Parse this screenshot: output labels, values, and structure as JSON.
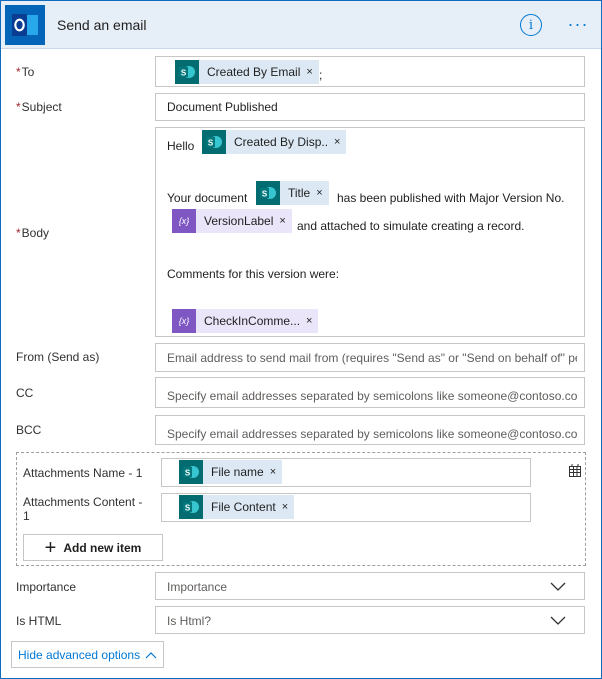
{
  "header": {
    "title": "Send an email",
    "app_icon": "outlook-icon",
    "info_icon": "info-icon",
    "more_icon": "more-ellipsis-icon"
  },
  "to": {
    "label": "To",
    "required_mark": "*",
    "token": {
      "label": "Created By Email",
      "remove": "×",
      "icon": "sharepoint-icon"
    },
    "separator": ";"
  },
  "subject": {
    "label": "Subject",
    "required_mark": "*",
    "value": "Document Published"
  },
  "body": {
    "label": "Body",
    "required_mark": "*",
    "hello": "Hello",
    "token_created_by": {
      "label": "Created By Disp..",
      "remove": "×",
      "icon": "sharepoint-icon"
    },
    "your_document": "Your document",
    "token_title": {
      "label": "Title",
      "remove": "×",
      "icon": "sharepoint-icon"
    },
    "published_text": "has been published with Major Version No.",
    "token_version": {
      "label": "VersionLabel",
      "remove": "×",
      "icon": "variable-icon",
      "icon_glyph": "{x}"
    },
    "attached_text": "and attached to simulate creating a record.",
    "comments_text": "Comments for this version were:",
    "token_checkin": {
      "label": "CheckInComme...",
      "remove": "×",
      "icon": "variable-icon",
      "icon_glyph": "{x}"
    }
  },
  "from": {
    "label": "From (Send as)",
    "placeholder": "Email address to send mail from (requires \"Send as\" or \"Send on behalf of\" pe"
  },
  "cc": {
    "label": "CC",
    "placeholder": "Specify email addresses separated by semicolons like someone@contoso.com"
  },
  "bcc": {
    "label": "BCC",
    "placeholder": "Specify email addresses separated by semicolons like someone@contoso.com"
  },
  "attachments": {
    "name_label": "Attachments Name - 1",
    "content_label_line1": "Attachments Content -",
    "content_label_line2": "1",
    "name_token": {
      "label": "File name",
      "remove": "×",
      "icon": "sharepoint-icon"
    },
    "content_token": {
      "label": "File Content",
      "remove": "×",
      "icon": "sharepoint-icon"
    },
    "add_button": "Add new item",
    "switch_icon": "table-switch-icon"
  },
  "importance": {
    "label": "Importance",
    "placeholder": "Importance"
  },
  "is_html": {
    "label": "Is HTML",
    "placeholder": "Is Html?"
  },
  "hide_advanced": "Hide advanced options",
  "colors": {
    "accent": "#0078d4",
    "sharepoint": "#036c70",
    "variable": "#7e57c2",
    "required": "#a4262c",
    "header_bg": "#e6eef8"
  }
}
